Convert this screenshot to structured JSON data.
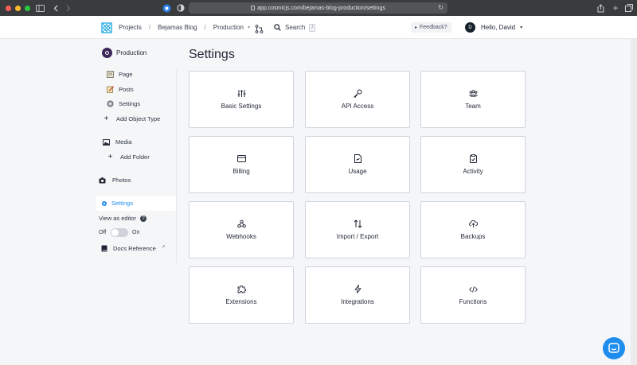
{
  "browser": {
    "url": "app.cosmicjs.com/bejamas-blog-production/settings",
    "colors": {
      "close": "#ff5f57",
      "minimize": "#febc2e",
      "zoom": "#28c840"
    }
  },
  "header": {
    "breadcrumbs": [
      "Projects",
      "Bejamas Blog",
      "Production"
    ],
    "separator": "/",
    "search_label": "Search",
    "search_shortcut": "/",
    "feedback_label": "Feedback?",
    "avatar_initial": "D",
    "greeting": "Hello, David"
  },
  "sidebar": {
    "bucket_name": "Production",
    "object_types": [
      {
        "label": "Page",
        "icon": "page-icon"
      },
      {
        "label": "Posts",
        "icon": "posts-icon"
      },
      {
        "label": "Settings",
        "icon": "gear-icon"
      }
    ],
    "add_object_type": "Add Object Type",
    "media_label": "Media",
    "add_folder": "Add Folder",
    "photos_label": "Photos",
    "settings_label": "Settings",
    "view_as_editor": "View as editor",
    "toggle_off": "Off",
    "toggle_on": "On",
    "toggle_state": "off",
    "docs_reference": "Docs Reference"
  },
  "main": {
    "title": "Settings",
    "cards": [
      {
        "label": "Basic Settings",
        "icon": "sliders-icon"
      },
      {
        "label": "API Access",
        "icon": "key-icon"
      },
      {
        "label": "Team",
        "icon": "team-icon"
      },
      {
        "label": "Billing",
        "icon": "credit-card-icon"
      },
      {
        "label": "Usage",
        "icon": "usage-doc-icon"
      },
      {
        "label": "Activity",
        "icon": "clipboard-check-icon"
      },
      {
        "label": "Webhooks",
        "icon": "webhooks-icon"
      },
      {
        "label": "Import / Export",
        "icon": "import-export-icon"
      },
      {
        "label": "Backups",
        "icon": "cloud-upload-icon"
      },
      {
        "label": "Extensions",
        "icon": "puzzle-icon"
      },
      {
        "label": "Integrations",
        "icon": "lightning-icon"
      },
      {
        "label": "Functions",
        "icon": "code-icon"
      }
    ]
  },
  "colors": {
    "accent": "#1f8ded",
    "logo": "#29abe2",
    "chat": "#1f8ded"
  }
}
